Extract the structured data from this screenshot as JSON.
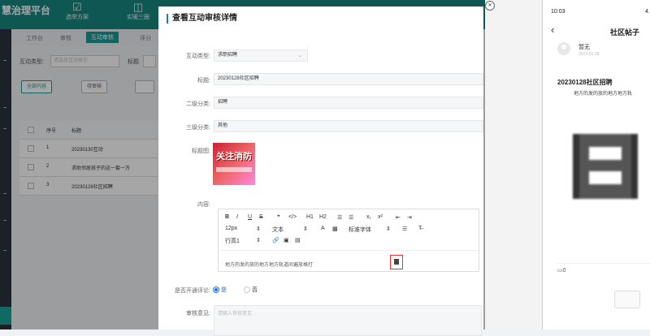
{
  "app": {
    "brand": "慧治理平台",
    "top_nav": [
      {
        "label": "选举方案",
        "icon": "vote-icon"
      },
      {
        "label": "实暖三圈",
        "icon": "circle-icon"
      }
    ],
    "sub_tabs": [
      "工作台",
      "审核",
      "互动审核",
      "评分"
    ],
    "filters": {
      "type_label": "互动类型:",
      "type_placeholder": "请选择互动类型",
      "title_label": "标题"
    },
    "buttons": {
      "all": "全部内容",
      "pending": "待审核"
    },
    "table": {
      "headers": [
        "序号",
        "标题"
      ],
      "rows": [
        {
          "no": "1",
          "title": "20230130互动"
        },
        {
          "no": "2",
          "title": "求助邻居孩子的这一套一万"
        },
        {
          "no": "3",
          "title": "20230128社区招聘"
        }
      ]
    }
  },
  "modal": {
    "title": "查看互动审核详情",
    "fields": {
      "interaction_type": {
        "label": "互动类型:",
        "value": "求职招聘"
      },
      "title": {
        "label": "标题:",
        "value": "20230128社区招聘"
      },
      "category2": {
        "label": "二级分类:",
        "value": "招聘"
      },
      "category3": {
        "label": "三级分类:",
        "value": "其他"
      },
      "title_image": {
        "label": "标题图:",
        "image_text": "关注消防"
      },
      "content": {
        "label": "内容:"
      },
      "comments": {
        "label": "是否开通评论:",
        "yes": "是",
        "no": "否"
      },
      "review": {
        "label": "审核意见:",
        "placeholder": "请输入审核意见"
      }
    },
    "editor": {
      "row1": [
        "B",
        "I",
        "U",
        "S",
        "❞",
        "</>",
        "H1",
        "H2",
        "☰",
        "☰",
        "x₁",
        "x²",
        "⇤",
        "⇥"
      ],
      "font_size": "12px",
      "font_type": "文本",
      "font_family": "标准字体",
      "line_height": "行高1",
      "content_text": "地方的发的放的地方地方轨道间遍放格打"
    }
  },
  "phone": {
    "time": "10:03",
    "time_right": "4.",
    "page_title": "社区帖子",
    "user_name": "暂无",
    "user_date": "2023-01-28",
    "post_title": "20230128社区招聘",
    "post_body": "地方的发的放的地方地方轨",
    "comment_count": "0"
  }
}
